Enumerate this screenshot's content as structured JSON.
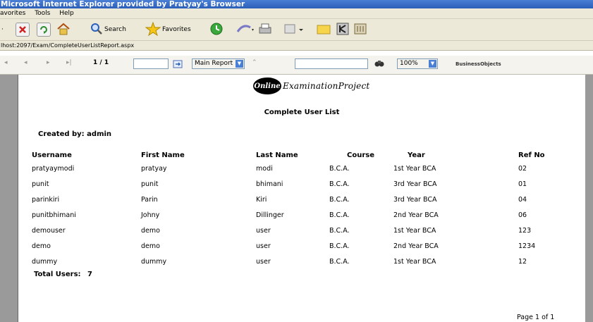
{
  "window": {
    "title": "Microsoft Internet Explorer provided by Pratyay's Browser"
  },
  "menu": {
    "items": [
      "avorites",
      "Tools",
      "Help"
    ]
  },
  "toolbar": {
    "search_label": "Search",
    "favorites_label": "Favorites"
  },
  "address": {
    "url": "lhost:2097/Exam/CompleteUserListReport.aspx"
  },
  "viewer": {
    "page_indicator": "1 / 1",
    "page_goto_value": "",
    "report_select": "Main Report",
    "search_value": "",
    "zoom": "100%",
    "brand": "BusinessObjects"
  },
  "report": {
    "logo_badge": "Online",
    "logo_text": "ExaminationProject",
    "title": "Complete User List",
    "created_by": "Created by: admin",
    "columns": [
      "Username",
      "First Name",
      "Last Name",
      "Course",
      "Year",
      "Ref No"
    ],
    "rows": [
      [
        "pratyaymodi",
        "pratyay",
        "modi",
        "B.C.A.",
        "1st Year BCA",
        "02"
      ],
      [
        "punit",
        "punit",
        "bhimani",
        "B.C.A.",
        "3rd Year BCA",
        "01"
      ],
      [
        "parinkiri",
        "Parin",
        "Kiri",
        "B.C.A.",
        "3rd Year BCA",
        "04"
      ],
      [
        "punitbhimani",
        "Johny",
        "Dillinger",
        "B.C.A.",
        "2nd Year BCA",
        "06"
      ],
      [
        "demouser",
        "demo",
        "user",
        "B.C.A.",
        "1st Year BCA",
        "123"
      ],
      [
        "demo",
        "demo",
        "user",
        "B.C.A.",
        "2nd Year BCA",
        "1234"
      ],
      [
        "dummy",
        "dummy",
        "user",
        "B.C.A.",
        "1st Year BCA",
        "12"
      ]
    ],
    "total_label": "Total Users:",
    "total_value": "7",
    "page_footer": "Page 1 of 1"
  }
}
